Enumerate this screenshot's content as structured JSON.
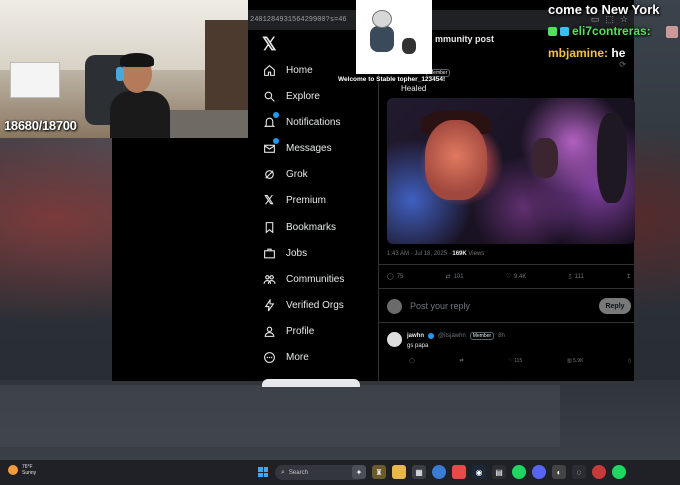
{
  "browser": {
    "url": "240128493156429900?s=46"
  },
  "sidebar": {
    "logo": "𝕏",
    "items": [
      {
        "label": "Home",
        "icon": "home-icon"
      },
      {
        "label": "Explore",
        "icon": "search-icon"
      },
      {
        "label": "Notifications",
        "icon": "bell-icon"
      },
      {
        "label": "Messages",
        "icon": "mail-icon"
      },
      {
        "label": "Grok",
        "icon": "grok-icon"
      },
      {
        "label": "Premium",
        "icon": "x-premium-icon"
      },
      {
        "label": "Bookmarks",
        "icon": "bookmark-icon"
      },
      {
        "label": "Jobs",
        "icon": "briefcase-icon"
      },
      {
        "label": "Communities",
        "icon": "people-icon"
      },
      {
        "label": "Verified Orgs",
        "icon": "lightning-icon"
      },
      {
        "label": "Profile",
        "icon": "person-icon"
      },
      {
        "label": "More",
        "icon": "more-circle-icon"
      }
    ]
  },
  "post": {
    "header": "mmunity post",
    "author_fragment": "3TIN",
    "member_tag": "Member",
    "text": "Healed",
    "time": "1:43 AM · Jul 18, 2025 · ",
    "views": "169K",
    "views_label": " Views",
    "actions": {
      "replies": "75",
      "reposts": "101",
      "likes": "9.4K",
      "bookmarks": "111"
    }
  },
  "reply_box": {
    "placeholder": "Post your reply",
    "button": "Reply"
  },
  "comment": {
    "name": "jawhn",
    "handle": "@itsjawhn",
    "member_tag": "Member",
    "time": "8h",
    "text": "gs papa",
    "likes": "115",
    "views": "5.9K"
  },
  "webcam": {
    "counter": "18680/18700"
  },
  "alert": {
    "text": "Welcome to Stable topher_123454!"
  },
  "chat": {
    "line1": "come to New York",
    "line2_user": "eli7contreras:",
    "line3_user": "mbjamine:",
    "line3_msg": "he"
  },
  "taskbar": {
    "temp": "76°F",
    "condition": "Sunny",
    "search": "Search"
  },
  "colors": {
    "accent": "#1d9bf0",
    "chat_green": "#54e05a",
    "chat_yellow": "#f0c04a"
  }
}
